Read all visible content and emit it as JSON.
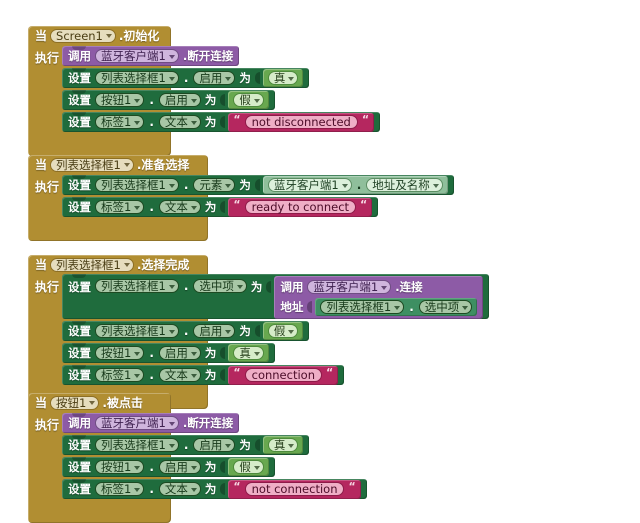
{
  "labels": {
    "when": "当",
    "do": "执行",
    "call": "调用",
    "set": "设置",
    "to": "为",
    "dot": ".",
    "quote": "“"
  },
  "components": {
    "screen1": "Screen1",
    "bluetooth_client": "蓝牙客户端1",
    "list_picker": "列表选择框1",
    "button": "按钮1",
    "label": "标签1"
  },
  "properties": {
    "enabled": "启用",
    "text": "文本",
    "elements": "元素",
    "selection": "选中项",
    "addresses_and_names": "地址及名称"
  },
  "methods": {
    "disconnect": ".断开连接",
    "connect": ".连接",
    "address_param": "地址"
  },
  "events": {
    "initialize": ".初始化",
    "before_picking": ".准备选择",
    "after_picking": ".选择完成",
    "click": ".被点击"
  },
  "logic": {
    "true": "真",
    "false": "假"
  },
  "strings": {
    "not_disconnected": "not disconnected",
    "ready_to_connect": "ready to connect",
    "connection": "connection",
    "not_connection": "not connection"
  },
  "colors": {
    "event_gold": "#b18e32",
    "setter_green": "#1f6c3d",
    "call_purple": "#8d5ba6",
    "logic_green": "#68a84f",
    "string_magenta": "#b5275f",
    "getter_green": "#3e8f62",
    "getter_pale": "#8fbf9b",
    "canvas": "#ffffff"
  },
  "blocks": [
    {
      "id": "screen1-initialize",
      "event_component": "Screen1",
      "event_name": ".初始化"
    },
    {
      "id": "listpicker-before-picking",
      "event_component": "列表选择框1",
      "event_name": ".准备选择"
    },
    {
      "id": "listpicker-after-picking",
      "event_component": "列表选择框1",
      "event_name": ".选择完成"
    },
    {
      "id": "button1-click",
      "event_component": "按钮1",
      "event_name": ".被点击"
    }
  ]
}
